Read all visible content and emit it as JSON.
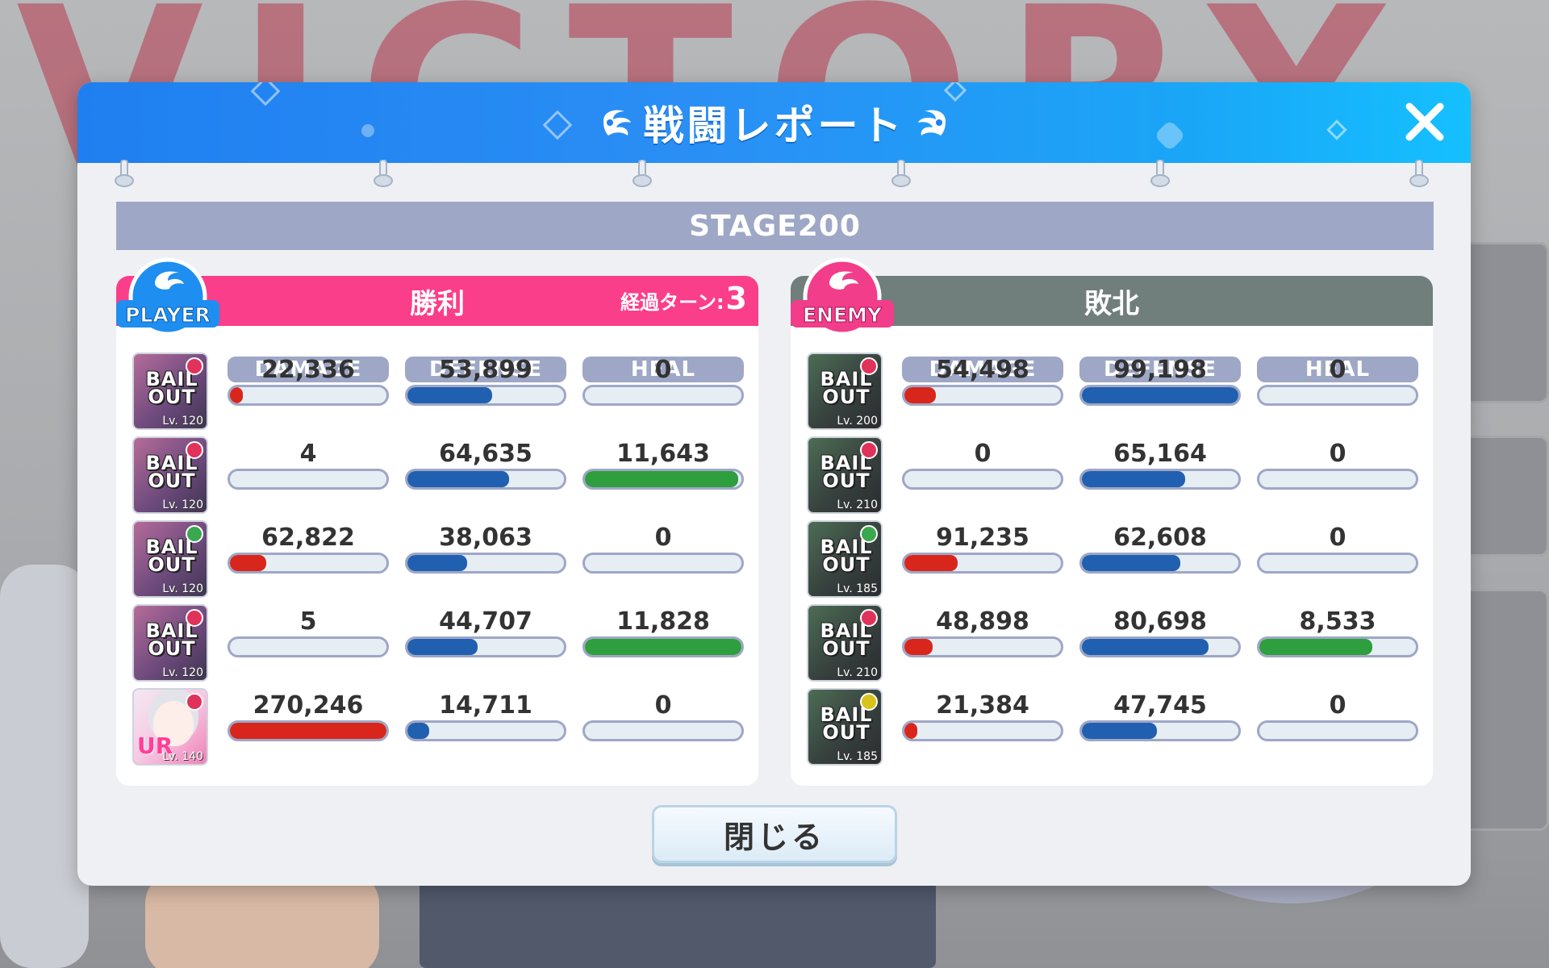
{
  "background": {
    "victory_text": "VICTORY"
  },
  "window": {
    "title": "戦闘レポート",
    "close_icon": "close-x-icon",
    "wing_icon": "wing-icon"
  },
  "stage": {
    "label": "STAGE200"
  },
  "colors": {
    "header_blue": "#1f7ff0",
    "player_pink": "#fb3e8a",
    "enemy_gray": "#707e7c",
    "damage_red": "#d9261c",
    "defense_blue": "#2160b0",
    "heal_green": "#2e9e3e",
    "column_header": "#9ea7c6"
  },
  "columns": [
    "DAMAGE",
    "DEFENSE",
    "HEAL"
  ],
  "player": {
    "badge": "PLAYER",
    "result": "勝利",
    "turns_label": "経過ターン:",
    "turns_value": "3",
    "units": [
      {
        "card": "BAIL OUT",
        "lv": "120",
        "rarity": "red",
        "damage": "22,336",
        "damage_ratio": 0.08,
        "defense": "53,899",
        "defense_ratio": 0.54,
        "heal": "0",
        "heal_ratio": 0
      },
      {
        "card": "BAIL OUT",
        "lv": "120",
        "rarity": "red",
        "damage": "4",
        "damage_ratio": 0,
        "defense": "64,635",
        "defense_ratio": 0.65,
        "heal": "11,643",
        "heal_ratio": 0.98
      },
      {
        "card": "BAIL OUT",
        "lv": "120",
        "rarity": "green",
        "damage": "62,822",
        "damage_ratio": 0.23,
        "defense": "38,063",
        "defense_ratio": 0.38,
        "heal": "0",
        "heal_ratio": 0
      },
      {
        "card": "BAIL OUT",
        "lv": "120",
        "rarity": "red",
        "damage": "5",
        "damage_ratio": 0,
        "defense": "44,707",
        "defense_ratio": 0.45,
        "heal": "11,828",
        "heal_ratio": 1.0
      },
      {
        "card": "UR",
        "lv": "140",
        "rarity": "red",
        "damage": "270,246",
        "damage_ratio": 1.0,
        "defense": "14,711",
        "defense_ratio": 0.14,
        "heal": "0",
        "heal_ratio": 0
      }
    ]
  },
  "enemy": {
    "badge": "ENEMY",
    "result": "敗北",
    "units": [
      {
        "card": "BAIL OUT",
        "lv": "200",
        "rarity": "red",
        "damage": "54,498",
        "damage_ratio": 0.2,
        "defense": "99,198",
        "defense_ratio": 1.0,
        "heal": "0",
        "heal_ratio": 0
      },
      {
        "card": "BAIL OUT",
        "lv": "210",
        "rarity": "red",
        "damage": "0",
        "damage_ratio": 0,
        "defense": "65,164",
        "defense_ratio": 0.66,
        "heal": "0",
        "heal_ratio": 0
      },
      {
        "card": "BAIL OUT",
        "lv": "185",
        "rarity": "green",
        "damage": "91,235",
        "damage_ratio": 0.34,
        "defense": "62,608",
        "defense_ratio": 0.63,
        "heal": "0",
        "heal_ratio": 0
      },
      {
        "card": "BAIL OUT",
        "lv": "210",
        "rarity": "red",
        "damage": "48,898",
        "damage_ratio": 0.18,
        "defense": "80,698",
        "defense_ratio": 0.81,
        "heal": "8,533",
        "heal_ratio": 0.72
      },
      {
        "card": "BAIL OUT",
        "lv": "185",
        "rarity": "yellow",
        "damage": "21,384",
        "damage_ratio": 0.08,
        "defense": "47,745",
        "defense_ratio": 0.48,
        "heal": "0",
        "heal_ratio": 0
      }
    ]
  },
  "footer": {
    "close_label": "閉じる"
  }
}
